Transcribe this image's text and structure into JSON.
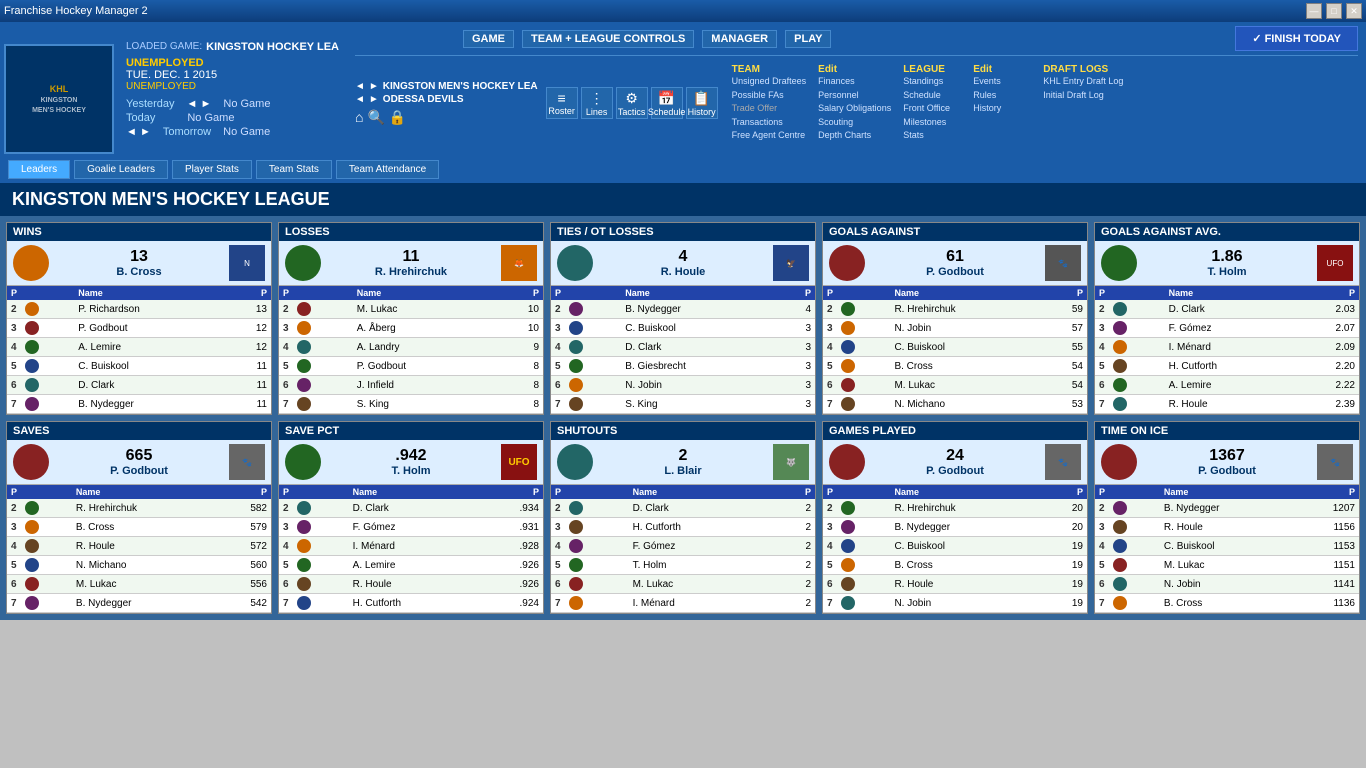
{
  "window": {
    "title": "Franchise Hockey Manager 2"
  },
  "header": {
    "loaded_label": "LOADED GAME:",
    "loaded_name": "KINGSTON HOCKEY LEA",
    "status": "UNEMPLOYED",
    "date": "TUE. DEC. 1 2015",
    "unemployed2": "UNEMPLOYED",
    "yesterday": "Yesterday",
    "today": "Today",
    "tomorrow": "Tomorrow",
    "no_game": "No Game",
    "nav_game": "GAME",
    "nav_team_league": "TEAM + LEAGUE CONTROLS",
    "nav_manager": "MANAGER",
    "nav_play": "PLAY",
    "finish_today": "✓ FINISH TODAY"
  },
  "team_selectors": {
    "team1": "KINGSTON MEN'S HOCKEY LEA",
    "team2": "ODESSA DEVILS"
  },
  "main_icons": {
    "roster": "Roster",
    "lines": "Lines",
    "tactics": "Tactics",
    "schedule": "Schedule",
    "history": "History"
  },
  "team_menu": {
    "title": "TEAM",
    "items": [
      "Unsigned Draftees",
      "Possible FAs",
      "Trade Offer",
      "Transactions",
      "Free Agent Centre"
    ]
  },
  "edit_menu": {
    "title": "Edit",
    "items": [
      "Finances",
      "Personnel",
      "Salary Obligations",
      "Scouting",
      "Depth Charts"
    ]
  },
  "league_menu": {
    "title": "LEAGUE",
    "items": [
      "Standings",
      "Schedule",
      "Front Office",
      "Milestones",
      "Stats"
    ]
  },
  "league_edit_menu": {
    "title": "Edit",
    "items": [
      "Events",
      "Rules",
      "History"
    ]
  },
  "draft_logs": {
    "title": "DRAFT LOGS",
    "items": [
      "KHL Entry Draft Log",
      "Initial Draft Log"
    ]
  },
  "tabs": {
    "leaders": "Leaders",
    "goalie_leaders": "Goalie Leaders",
    "player_stats": "Player Stats",
    "team_stats": "Team Stats",
    "team_attendance": "Team Attendance"
  },
  "page_title": "KINGSTON MEN'S HOCKEY LEAGUE",
  "cards": {
    "wins": {
      "title": "WINS",
      "leader_value": "13",
      "leader_name": "B. Cross",
      "rows": [
        {
          "pos": "2",
          "name": "P. Richardson",
          "val": "13"
        },
        {
          "pos": "3",
          "name": "P. Godbout",
          "val": "12"
        },
        {
          "pos": "4",
          "name": "A. Lemire",
          "val": "12"
        },
        {
          "pos": "5",
          "name": "C. Buiskool",
          "val": "11"
        },
        {
          "pos": "6",
          "name": "D. Clark",
          "val": "11"
        },
        {
          "pos": "7",
          "name": "B. Nydegger",
          "val": "11"
        }
      ]
    },
    "losses": {
      "title": "LOSSES",
      "leader_value": "11",
      "leader_name": "R. Hrehirchuk",
      "rows": [
        {
          "pos": "2",
          "name": "M. Lukac",
          "val": "10"
        },
        {
          "pos": "3",
          "name": "A. Åberg",
          "val": "10"
        },
        {
          "pos": "4",
          "name": "A. Landry",
          "val": "9"
        },
        {
          "pos": "5",
          "name": "P. Godbout",
          "val": "8"
        },
        {
          "pos": "6",
          "name": "J. Infield",
          "val": "8"
        },
        {
          "pos": "7",
          "name": "S. King",
          "val": "8"
        }
      ]
    },
    "ties_ot": {
      "title": "TIES / OT LOSSES",
      "leader_value": "4",
      "leader_name": "R. Houle",
      "rows": [
        {
          "pos": "2",
          "name": "B. Nydegger",
          "val": "4"
        },
        {
          "pos": "3",
          "name": "C. Buiskool",
          "val": "3"
        },
        {
          "pos": "4",
          "name": "D. Clark",
          "val": "3"
        },
        {
          "pos": "5",
          "name": "B. Giesbrecht",
          "val": "3"
        },
        {
          "pos": "6",
          "name": "N. Jobin",
          "val": "3"
        },
        {
          "pos": "7",
          "name": "S. King",
          "val": "3"
        }
      ]
    },
    "goals_against": {
      "title": "GOALS AGAINST",
      "leader_value": "61",
      "leader_name": "P. Godbout",
      "rows": [
        {
          "pos": "2",
          "name": "R. Hrehirchuk",
          "val": "59"
        },
        {
          "pos": "3",
          "name": "N. Jobin",
          "val": "57"
        },
        {
          "pos": "4",
          "name": "C. Buiskool",
          "val": "55"
        },
        {
          "pos": "5",
          "name": "B. Cross",
          "val": "54"
        },
        {
          "pos": "6",
          "name": "M. Lukac",
          "val": "54"
        },
        {
          "pos": "7",
          "name": "N. Michano",
          "val": "53"
        }
      ]
    },
    "goals_against_avg": {
      "title": "GOALS AGAINST AVG.",
      "leader_value": "1.86",
      "leader_name": "T. Holm",
      "rows": [
        {
          "pos": "2",
          "name": "D. Clark",
          "val": "2.03"
        },
        {
          "pos": "3",
          "name": "F. Gómez",
          "val": "2.07"
        },
        {
          "pos": "4",
          "name": "I. Ménard",
          "val": "2.09"
        },
        {
          "pos": "5",
          "name": "H. Cutforth",
          "val": "2.20"
        },
        {
          "pos": "6",
          "name": "A. Lemire",
          "val": "2.22"
        },
        {
          "pos": "7",
          "name": "R. Houle",
          "val": "2.39"
        }
      ]
    },
    "saves": {
      "title": "SAVES",
      "leader_value": "665",
      "leader_name": "P. Godbout",
      "rows": [
        {
          "pos": "2",
          "name": "R. Hrehirchuk",
          "val": "582"
        },
        {
          "pos": "3",
          "name": "B. Cross",
          "val": "579"
        },
        {
          "pos": "4",
          "name": "R. Houle",
          "val": "572"
        },
        {
          "pos": "5",
          "name": "N. Michano",
          "val": "560"
        },
        {
          "pos": "6",
          "name": "M. Lukac",
          "val": "556"
        },
        {
          "pos": "7",
          "name": "B. Nydegger",
          "val": "542"
        }
      ]
    },
    "save_pct": {
      "title": "SAVE PCT",
      "leader_value": ".942",
      "leader_name": "T. Holm",
      "rows": [
        {
          "pos": "2",
          "name": "D. Clark",
          "val": ".934"
        },
        {
          "pos": "3",
          "name": "F. Gómez",
          "val": ".931"
        },
        {
          "pos": "4",
          "name": "I. Ménard",
          "val": ".928"
        },
        {
          "pos": "5",
          "name": "A. Lemire",
          "val": ".926"
        },
        {
          "pos": "6",
          "name": "R. Houle",
          "val": ".926"
        },
        {
          "pos": "7",
          "name": "H. Cutforth",
          "val": ".924"
        }
      ]
    },
    "shutouts": {
      "title": "SHUTOUTS",
      "leader_value": "2",
      "leader_name": "L. Blair",
      "rows": [
        {
          "pos": "2",
          "name": "D. Clark",
          "val": "2"
        },
        {
          "pos": "3",
          "name": "H. Cutforth",
          "val": "2"
        },
        {
          "pos": "4",
          "name": "F. Gómez",
          "val": "2"
        },
        {
          "pos": "5",
          "name": "T. Holm",
          "val": "2"
        },
        {
          "pos": "6",
          "name": "M. Lukac",
          "val": "2"
        },
        {
          "pos": "7",
          "name": "I. Ménard",
          "val": "2"
        }
      ]
    },
    "games_played": {
      "title": "GAMES PLAYED",
      "leader_value": "24",
      "leader_name": "P. Godbout",
      "rows": [
        {
          "pos": "2",
          "name": "R. Hrehirchuk",
          "val": "20"
        },
        {
          "pos": "3",
          "name": "B. Nydegger",
          "val": "20"
        },
        {
          "pos": "4",
          "name": "C. Buiskool",
          "val": "19"
        },
        {
          "pos": "5",
          "name": "B. Cross",
          "val": "19"
        },
        {
          "pos": "6",
          "name": "R. Houle",
          "val": "19"
        },
        {
          "pos": "7",
          "name": "N. Jobin",
          "val": "19"
        }
      ]
    },
    "time_on_ice": {
      "title": "TIME ON ICE",
      "leader_value": "1367",
      "leader_name": "P. Godbout",
      "rows": [
        {
          "pos": "2",
          "name": "B. Nydegger",
          "val": "1207"
        },
        {
          "pos": "3",
          "name": "R. Houle",
          "val": "1156"
        },
        {
          "pos": "4",
          "name": "C. Buiskool",
          "val": "1153"
        },
        {
          "pos": "5",
          "name": "M. Lukac",
          "val": "1151"
        },
        {
          "pos": "6",
          "name": "N. Jobin",
          "val": "1141"
        },
        {
          "pos": "7",
          "name": "B. Cross",
          "val": "1136"
        }
      ]
    }
  }
}
